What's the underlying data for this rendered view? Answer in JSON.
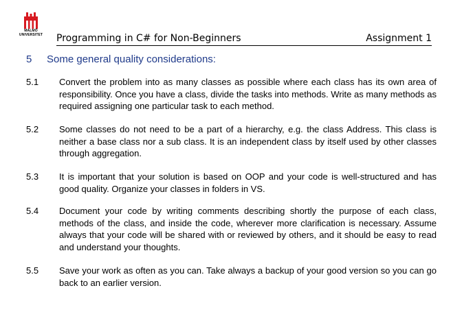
{
  "logo": {
    "line1": "MALMÖ",
    "line2": "UNIVERSITET"
  },
  "header": {
    "title": "Programming in C# for Non-Beginners",
    "assignment": "Assignment 1"
  },
  "section": {
    "number": "5",
    "title": "Some general quality considerations:"
  },
  "items": [
    {
      "number": "5.1",
      "text": "Convert the problem into as many classes as possible where each class has its own area of responsibility. Once you have a class, divide the tasks into methods. Write as many methods as required assigning one particular task to each method."
    },
    {
      "number": "5.2",
      "text": "Some classes do not need to be a part of a hierarchy, e.g. the class Address. This class is neither a base class nor a sub class. It is an independent class by itself used by other classes through aggregation."
    },
    {
      "number": "5.3",
      "text": "It is important that your solution is based on OOP and your code is well-structured and has good quality.  Organize your classes in folders in VS."
    },
    {
      "number": "5.4",
      "text": "Document your code by writing comments describing shortly the purpose of each class, methods of the class, and inside the code, wherever more clarification is necessary. Assume always that your code will be shared with or reviewed by others, and it should be easy to read and understand your thoughts."
    },
    {
      "number": "5.5",
      "text": "Save your work as often as you can.  Take always a backup of your good version so you can go back to an earlier version."
    }
  ],
  "colors": {
    "logo_red": "#d71920",
    "heading_blue": "#1f3a8a"
  }
}
